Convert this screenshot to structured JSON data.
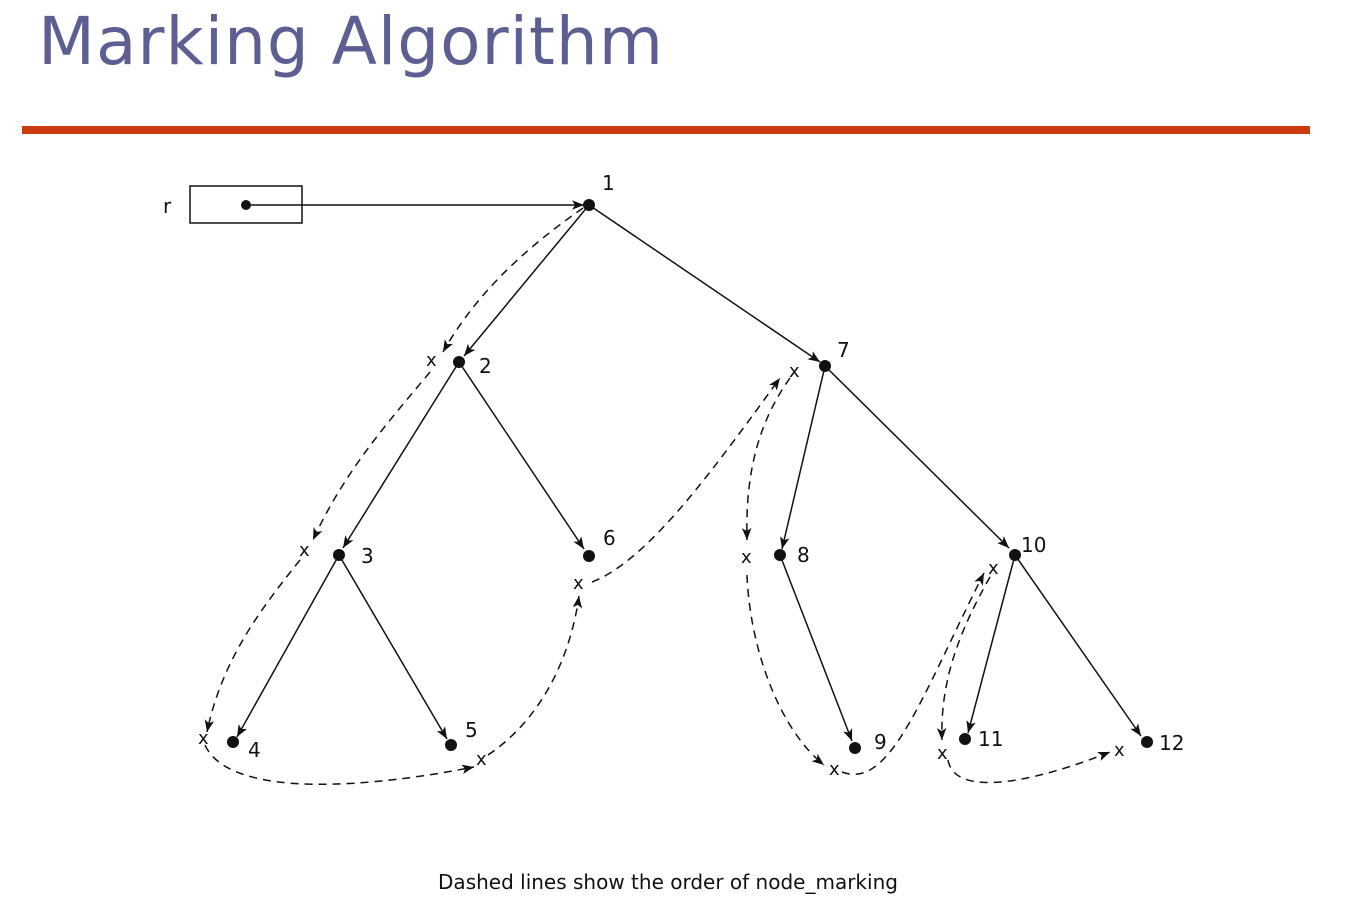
{
  "title": "Marking Algorithm",
  "caption": "Dashed lines show the order of node_marking",
  "colors": {
    "title": "#5d5f92",
    "rule": "#cc3a0e",
    "ink": "#111111"
  },
  "root_label": "r",
  "mark_symbol": "x",
  "nodes": [
    {
      "id": "1",
      "label": "1"
    },
    {
      "id": "2",
      "label": "2"
    },
    {
      "id": "3",
      "label": "3"
    },
    {
      "id": "4",
      "label": "4"
    },
    {
      "id": "5",
      "label": "5"
    },
    {
      "id": "6",
      "label": "6"
    },
    {
      "id": "7",
      "label": "7"
    },
    {
      "id": "8",
      "label": "8"
    },
    {
      "id": "9",
      "label": "9"
    },
    {
      "id": "10",
      "label": "10"
    },
    {
      "id": "11",
      "label": "11"
    },
    {
      "id": "12",
      "label": "12"
    }
  ],
  "edges": [
    {
      "from": "1",
      "to": "2"
    },
    {
      "from": "1",
      "to": "7"
    },
    {
      "from": "2",
      "to": "3"
    },
    {
      "from": "2",
      "to": "6"
    },
    {
      "from": "3",
      "to": "4"
    },
    {
      "from": "3",
      "to": "5"
    },
    {
      "from": "7",
      "to": "8"
    },
    {
      "from": "7",
      "to": "10"
    },
    {
      "from": "8",
      "to": "9"
    },
    {
      "from": "10",
      "to": "11"
    },
    {
      "from": "10",
      "to": "12"
    }
  ]
}
